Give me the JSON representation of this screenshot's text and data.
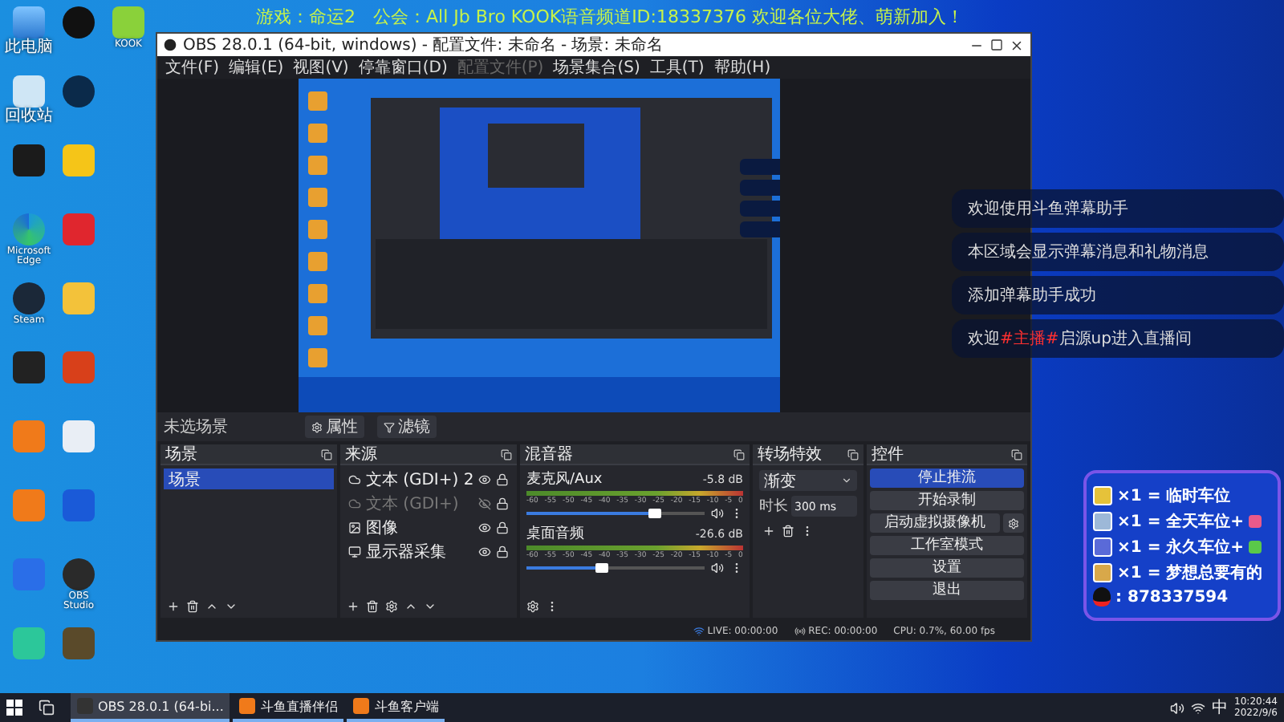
{
  "banner": "游戏：命运2　公会：All Jb Bro  KOOK语音频道ID:18337376  欢迎各位大佬、萌新加入！",
  "desktop_rows": [
    [
      {
        "kind": "pc",
        "label": "此电脑"
      },
      {
        "kind": "qq"
      },
      {
        "kind": "kook",
        "label": "KOOK"
      }
    ],
    [
      {
        "kind": "bin",
        "label": "回收站"
      },
      {
        "kind": "ring"
      }
    ],
    [
      {
        "kind": "nvidia"
      },
      {
        "kind": "yellow"
      }
    ],
    [
      {
        "kind": "edge",
        "label": "Microsoft Edge"
      },
      {
        "kind": "music"
      }
    ],
    [
      {
        "kind": "steam",
        "label": "Steam"
      },
      {
        "kind": "cat"
      }
    ],
    [
      {
        "kind": "wegame"
      },
      {
        "kind": "cf"
      }
    ],
    [
      {
        "kind": "orange"
      },
      {
        "kind": "destiny"
      }
    ],
    [
      {
        "kind": "orange"
      },
      {
        "kind": "camera"
      }
    ],
    [
      {
        "kind": "blue"
      },
      {
        "kind": "obs",
        "label": "OBS Studio"
      }
    ],
    [
      {
        "kind": "green"
      },
      {
        "kind": "emblem"
      }
    ]
  ],
  "obs": {
    "title": "OBS 28.0.1 (64-bit, windows) - 配置文件: 未命名 - 场景: 未命名",
    "menu": [
      {
        "label": "文件(F)",
        "disabled": false
      },
      {
        "label": "编辑(E)",
        "disabled": false
      },
      {
        "label": "视图(V)",
        "disabled": false
      },
      {
        "label": "停靠窗口(D)",
        "disabled": false
      },
      {
        "label": "配置文件(P)",
        "disabled": true
      },
      {
        "label": "场景集合(S)",
        "disabled": false
      },
      {
        "label": "工具(T)",
        "disabled": false
      },
      {
        "label": "帮助(H)",
        "disabled": false
      }
    ],
    "scene_bar": {
      "label": "未选场景",
      "buttons": [
        "属性",
        "滤镜"
      ]
    },
    "scenes": {
      "title": "场景",
      "items": [
        {
          "label": "场景",
          "selected": true
        }
      ]
    },
    "sources": {
      "title": "来源",
      "items": [
        {
          "kind": "text",
          "label": "文本 (GDI+) 2",
          "visible": true
        },
        {
          "kind": "text",
          "label": "文本 (GDI+)",
          "visible": false
        },
        {
          "kind": "image",
          "label": "图像",
          "visible": true
        },
        {
          "kind": "display",
          "label": "显示器采集",
          "visible": true
        }
      ]
    },
    "mixer": {
      "title": "混音器",
      "channels": [
        {
          "name": "麦克风/Aux",
          "reading": "-5.8 dB",
          "level": 0.72,
          "ticks": [
            "-60",
            "-55",
            "-50",
            "-45",
            "-40",
            "-35",
            "-30",
            "-25",
            "-20",
            "-15",
            "-10",
            "-5",
            "0"
          ]
        },
        {
          "name": "桌面音频",
          "reading": "-26.6 dB",
          "level": 0.42,
          "ticks": [
            "-60",
            "-55",
            "-50",
            "-45",
            "-40",
            "-35",
            "-30",
            "-25",
            "-20",
            "-15",
            "-10",
            "-5",
            "0"
          ]
        }
      ]
    },
    "transitions": {
      "title": "转场特效",
      "selected": "渐变",
      "duration_label": "时长",
      "duration": "300 ms"
    },
    "controls": {
      "title": "控件",
      "buttons": [
        {
          "label": "停止推流",
          "active": true,
          "gear": false
        },
        {
          "label": "开始录制",
          "active": false,
          "gear": false
        },
        {
          "label": "启动虚拟摄像机",
          "active": false,
          "gear": true
        },
        {
          "label": "工作室模式",
          "active": false,
          "gear": false
        },
        {
          "label": "设置",
          "active": false,
          "gear": false
        },
        {
          "label": "退出",
          "active": false,
          "gear": false
        }
      ]
    },
    "status": {
      "live": "LIVE: 00:00:00",
      "rec": "REC: 00:00:00",
      "cpu": "CPU: 0.7%, 60.00 fps"
    }
  },
  "chat": [
    {
      "parts": [
        {
          "text": "欢迎使用斗鱼弹幕助手",
          "highlight": false
        }
      ]
    },
    {
      "parts": [
        {
          "text": "本区域会显示弹幕消息和礼物消息",
          "highlight": false
        }
      ]
    },
    {
      "parts": [
        {
          "text": "添加弹幕助手成功",
          "highlight": false
        }
      ]
    },
    {
      "parts": [
        {
          "text": "欢迎",
          "highlight": false
        },
        {
          "text": "#主播#",
          "highlight": true
        },
        {
          "text": "启源up进入直播间",
          "highlight": false
        }
      ]
    }
  ],
  "rewards": {
    "rows": [
      {
        "text": "×1 = 临时车位",
        "bonus": false
      },
      {
        "text": "×1 = 全天车位+",
        "bonus": true
      },
      {
        "text": "×1 = 永久车位+",
        "bonus": true
      },
      {
        "text": "×1 = 梦想总要有的",
        "bonus": false
      }
    ],
    "qq": ": 878337594"
  },
  "taskbar": {
    "tasks": [
      {
        "label": "OBS 28.0.1 (64-bi...",
        "selected": true
      },
      {
        "label": "斗鱼直播伴侣",
        "selected": false
      },
      {
        "label": "斗鱼客户端",
        "selected": false
      }
    ],
    "ime": "中",
    "time": "10:20:44",
    "date": "2022/9/6"
  }
}
